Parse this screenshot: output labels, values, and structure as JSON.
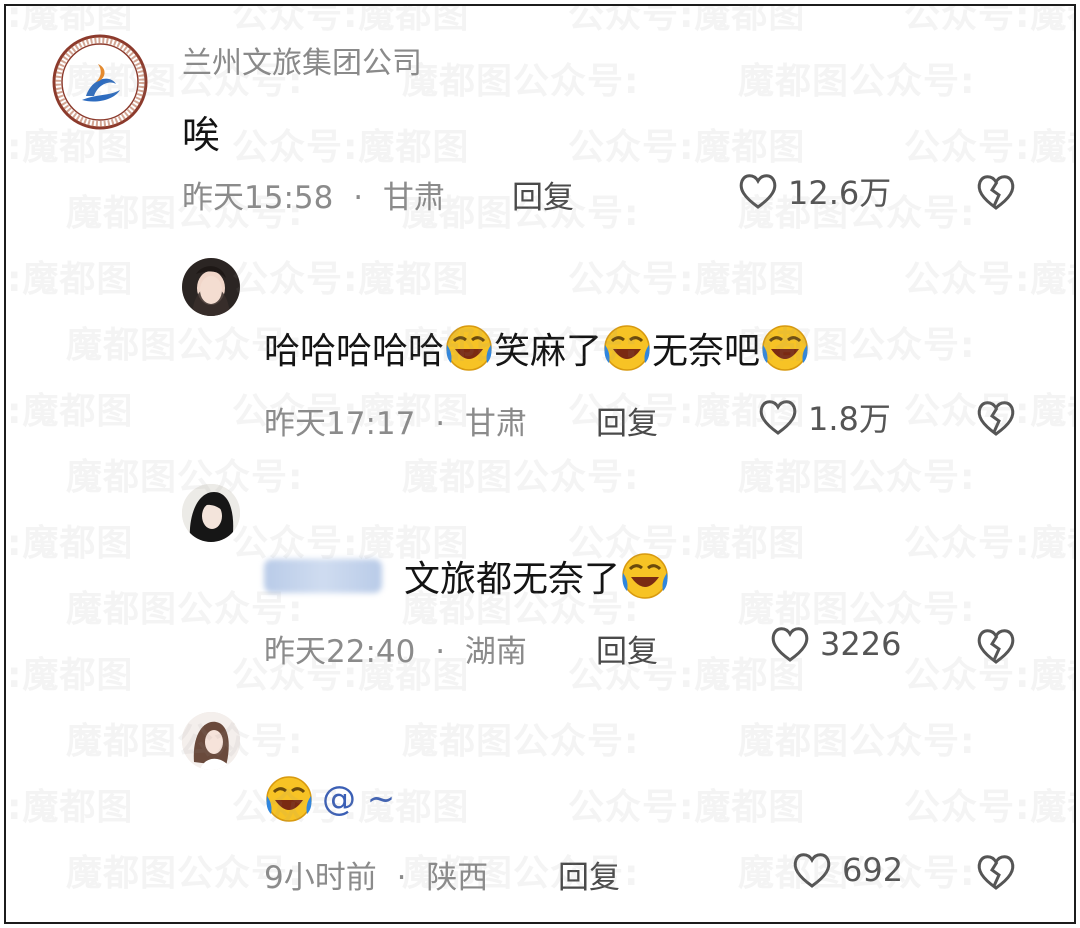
{
  "watermark": {
    "text_a": "公众号:",
    "text_b": "魔都图"
  },
  "comments": [
    {
      "author": "兰州文旅集团公司",
      "text": "唉",
      "time": "昨天15:58",
      "location": "甘肃",
      "reply_label": "回复",
      "likes": "12.6万"
    },
    {
      "author": "",
      "text_parts": [
        "哈哈哈哈哈",
        "笑麻了",
        "无奈吧"
      ],
      "time": "昨天17:17",
      "location": "甘肃",
      "reply_label": "回复",
      "likes": "1.8万"
    },
    {
      "author": "",
      "text": "文旅都无奈了",
      "time": "昨天22:40",
      "location": "湖南",
      "reply_label": "回复",
      "likes": "3226"
    },
    {
      "author": "",
      "text": "@ ~",
      "time": "9小时前",
      "location": "陕西",
      "reply_label": "回复",
      "likes": "692"
    }
  ],
  "separator": "·",
  "icons": {
    "like": "heart-outline-icon",
    "dislike": "broken-heart-icon",
    "emoji": "laughing-crying-emoji"
  },
  "colors": {
    "meta_gray": "#8b8b8b",
    "text_dark": "#141414",
    "logo_blue": "#2d6cc0",
    "logo_orange": "#e58a2e",
    "logo_ring": "#8c3a2c",
    "emoji_yellow": "#f7c325",
    "emoji_blue": "#2f86de"
  }
}
